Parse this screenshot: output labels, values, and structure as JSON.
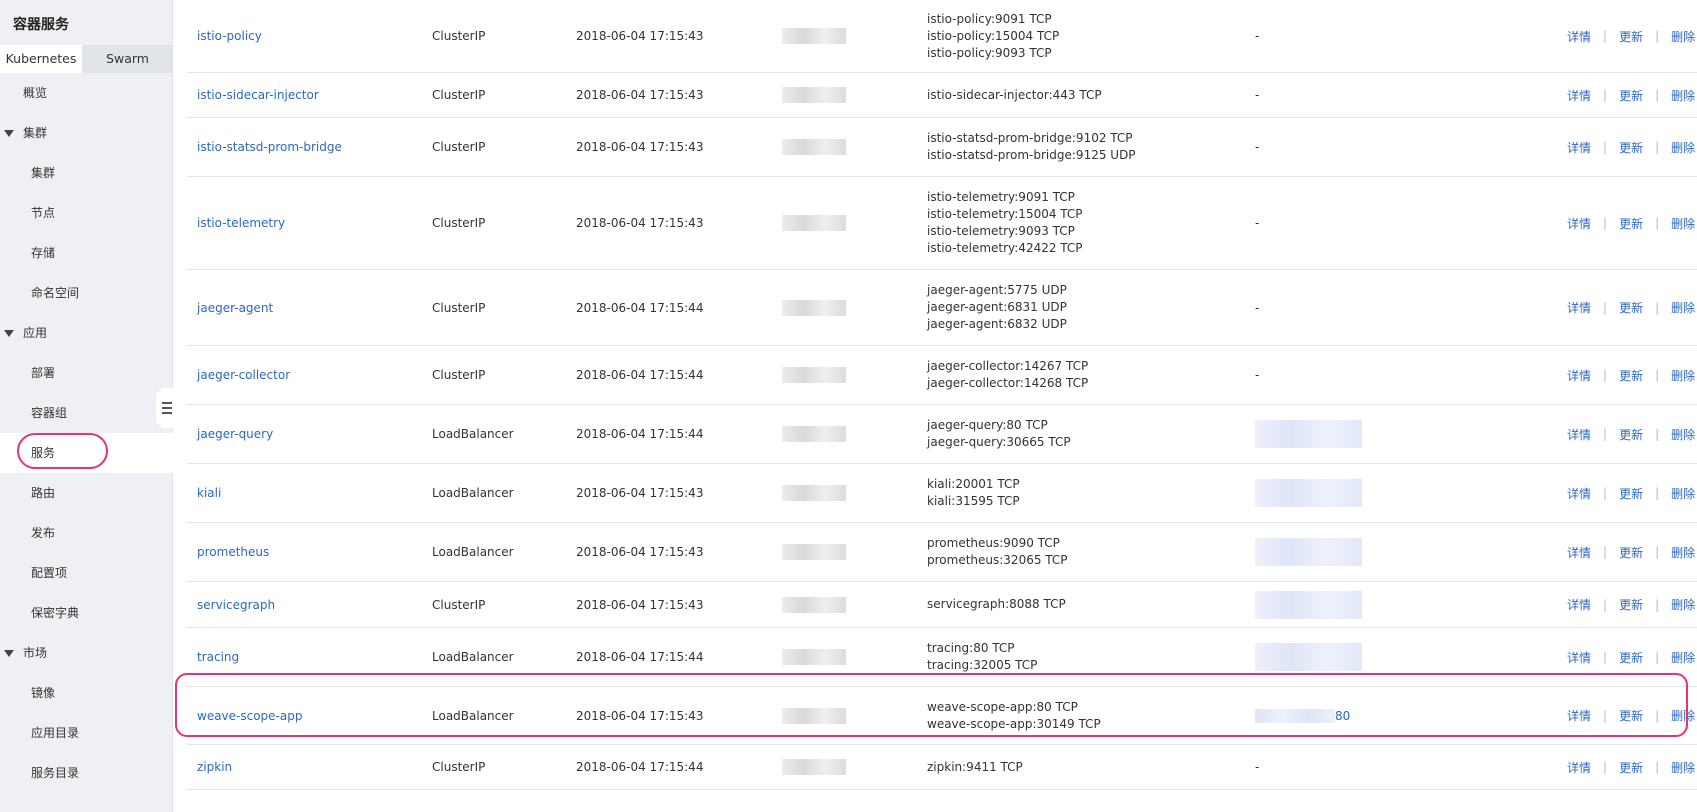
{
  "sidebar": {
    "title": "容器服务",
    "tabs": [
      "Kubernetes",
      "Swarm"
    ],
    "overview": "概览",
    "groups": [
      {
        "label": "集群",
        "items": [
          "集群",
          "节点",
          "存储",
          "命名空间"
        ]
      },
      {
        "label": "应用",
        "items": [
          "部署",
          "容器组",
          "服务",
          "路由",
          "发布",
          "配置项",
          "保密字典"
        ]
      },
      {
        "label": "市场",
        "items": [
          "镜像",
          "应用目录",
          "服务目录"
        ]
      }
    ],
    "active_item": "服务"
  },
  "operations": {
    "detail": "详情",
    "update": "更新",
    "delete": "删除"
  },
  "services": [
    {
      "name": "istio-policy",
      "type": "ClusterIP",
      "created": "2018-06-04 17:15:43",
      "ports": [
        "istio-policy:9091 TCP",
        "istio-policy:15004 TCP",
        "istio-policy:9093 TCP"
      ],
      "external": "-"
    },
    {
      "name": "istio-sidecar-injector",
      "type": "ClusterIP",
      "created": "2018-06-04 17:15:43",
      "ports": [
        "istio-sidecar-injector:443 TCP"
      ],
      "external": "-"
    },
    {
      "name": "istio-statsd-prom-bridge",
      "type": "ClusterIP",
      "created": "2018-06-04 17:15:43",
      "ports": [
        "istio-statsd-prom-bridge:9102 TCP",
        "istio-statsd-prom-bridge:9125 UDP"
      ],
      "external": "-"
    },
    {
      "name": "istio-telemetry",
      "type": "ClusterIP",
      "created": "2018-06-04 17:15:43",
      "ports": [
        "istio-telemetry:9091 TCP",
        "istio-telemetry:15004 TCP",
        "istio-telemetry:9093 TCP",
        "istio-telemetry:42422 TCP"
      ],
      "external": "-"
    },
    {
      "name": "jaeger-agent",
      "type": "ClusterIP",
      "created": "2018-06-04 17:15:44",
      "ports": [
        "jaeger-agent:5775 UDP",
        "jaeger-agent:6831 UDP",
        "jaeger-agent:6832 UDP"
      ],
      "external": "-"
    },
    {
      "name": "jaeger-collector",
      "type": "ClusterIP",
      "created": "2018-06-04 17:15:44",
      "ports": [
        "jaeger-collector:14267 TCP",
        "jaeger-collector:14268 TCP"
      ],
      "external": "-"
    },
    {
      "name": "jaeger-query",
      "type": "LoadBalancer",
      "created": "2018-06-04 17:15:44",
      "ports": [
        "jaeger-query:80 TCP",
        "jaeger-query:30665 TCP"
      ],
      "external": ""
    },
    {
      "name": "kiali",
      "type": "LoadBalancer",
      "created": "2018-06-04 17:15:43",
      "ports": [
        "kiali:20001 TCP",
        "kiali:31595 TCP"
      ],
      "external": ""
    },
    {
      "name": "prometheus",
      "type": "LoadBalancer",
      "created": "2018-06-04 17:15:43",
      "ports": [
        "prometheus:9090 TCP",
        "prometheus:32065 TCP"
      ],
      "external": ""
    },
    {
      "name": "servicegraph",
      "type": "ClusterIP",
      "created": "2018-06-04 17:15:43",
      "ports": [
        "servicegraph:8088 TCP"
      ],
      "external": ""
    },
    {
      "name": "tracing",
      "type": "LoadBalancer",
      "created": "2018-06-04 17:15:44",
      "ports": [
        "tracing:80 TCP",
        "tracing:32005 TCP"
      ],
      "external": ""
    },
    {
      "name": "weave-scope-app",
      "type": "LoadBalancer",
      "created": "2018-06-04 17:15:43",
      "ports": [
        "weave-scope-app:80 TCP",
        "weave-scope-app:30149 TCP"
      ],
      "external": "80"
    },
    {
      "name": "zipkin",
      "type": "ClusterIP",
      "created": "2018-06-04 17:15:44",
      "ports": [
        "zipkin:9411 TCP"
      ],
      "external": "-"
    }
  ],
  "colors": {
    "link": "#2c68c2",
    "highlight": "#e8336b",
    "sidebar_bg": "#eef0f3"
  }
}
